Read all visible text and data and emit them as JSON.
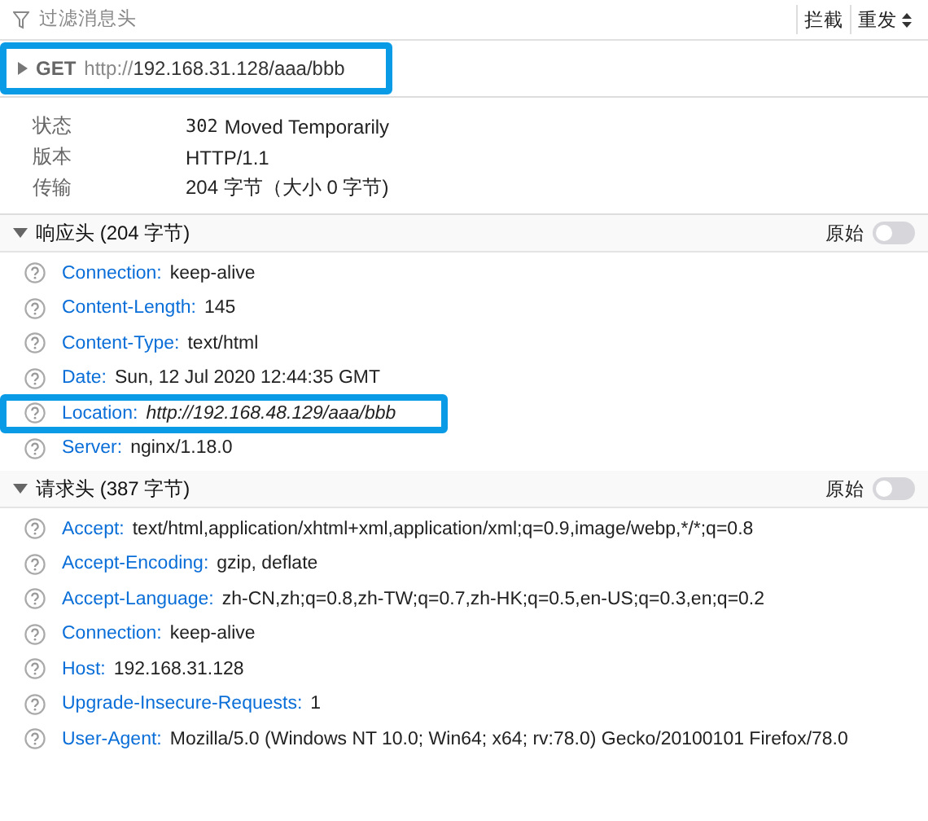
{
  "toolbar": {
    "filter_placeholder": "过滤消息头",
    "buttons": [
      {
        "label": "拦截",
        "kind": "plain"
      },
      {
        "label": "重发",
        "kind": "dropdown"
      }
    ]
  },
  "request": {
    "expanded": false,
    "method": "GET",
    "url_prefix": "http://",
    "url_rest": "192.168.31.128/aaa/bbb",
    "highlighted": true
  },
  "summary": [
    {
      "label": "状态",
      "status_code": "302",
      "value": "Moved Temporarily"
    },
    {
      "label": "版本",
      "value": "HTTP/1.1"
    },
    {
      "label": "传输",
      "value": "204 字节（大小 0 字节)"
    }
  ],
  "sections": [
    {
      "title": "响应头 (204 字节)",
      "expanded": true,
      "raw_label": "原始",
      "raw_on": false,
      "headers": [
        {
          "name": "Connection:",
          "value": "keep-alive",
          "italic": false,
          "highlighted": false
        },
        {
          "name": "Content-Length:",
          "value": "145",
          "italic": false,
          "highlighted": false
        },
        {
          "name": "Content-Type:",
          "value": "text/html",
          "italic": false,
          "highlighted": false
        },
        {
          "name": "Date:",
          "value": "Sun, 12 Jul 2020 12:44:35 GMT",
          "italic": false,
          "highlighted": false
        },
        {
          "name": "Location:",
          "value": "http://192.168.48.129/aaa/bbb",
          "italic": true,
          "highlighted": true
        },
        {
          "name": "Server:",
          "value": "nginx/1.18.0",
          "italic": false,
          "highlighted": false
        }
      ]
    },
    {
      "title": "请求头 (387 字节)",
      "expanded": true,
      "raw_label": "原始",
      "raw_on": false,
      "headers": [
        {
          "name": "Accept:",
          "value": "text/html,application/xhtml+xml,application/xml;q=0.9,image/webp,*/*;q=0.8",
          "italic": false,
          "highlighted": false
        },
        {
          "name": "Accept-Encoding:",
          "value": "gzip, deflate",
          "italic": false,
          "highlighted": false
        },
        {
          "name": "Accept-Language:",
          "value": "zh-CN,zh;q=0.8,zh-TW;q=0.7,zh-HK;q=0.5,en-US;q=0.3,en;q=0.2",
          "italic": false,
          "highlighted": false
        },
        {
          "name": "Connection:",
          "value": "keep-alive",
          "italic": false,
          "highlighted": false
        },
        {
          "name": "Host:",
          "value": "192.168.31.128",
          "italic": false,
          "highlighted": false
        },
        {
          "name": "Upgrade-Insecure-Requests:",
          "value": "1",
          "italic": false,
          "highlighted": false
        },
        {
          "name": "User-Agent:",
          "value": "Mozilla/5.0 (Windows NT 10.0; Win64; x64; rv:78.0) Gecko/20100101 Firefox/78.0",
          "italic": false,
          "highlighted": false
        }
      ]
    }
  ]
}
